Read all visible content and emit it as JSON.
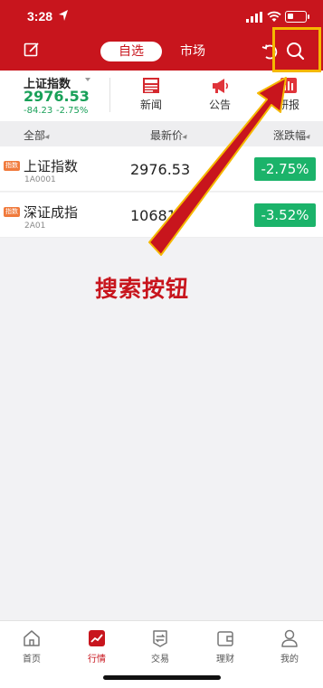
{
  "status_bar": {
    "time": "3:28"
  },
  "nav": {
    "tabs": [
      {
        "label": "自选",
        "active": true
      },
      {
        "label": "市场",
        "active": false
      }
    ]
  },
  "index_summary": {
    "name": "上证指数",
    "value": "2976.53",
    "change": "-84.23",
    "change_pct": "-2.75%",
    "color": "#18a058"
  },
  "quick_actions": [
    {
      "label": "新闻",
      "icon": "news-icon"
    },
    {
      "label": "公告",
      "icon": "megaphone-icon"
    },
    {
      "label": "研报",
      "icon": "research-report-icon"
    }
  ],
  "table": {
    "headers": {
      "name": "全部",
      "price": "最新价",
      "change_pct": "涨跌幅"
    },
    "rows": [
      {
        "badge": "指数",
        "name": "上证指数",
        "code": "1A0001",
        "price": "2976.53",
        "change_pct": "-2.75%"
      },
      {
        "badge": "指数",
        "name": "深证成指",
        "code": "2A01",
        "price": "10681.9",
        "change_pct": "-3.52%"
      }
    ]
  },
  "annotation": {
    "text": "搜索按钮"
  },
  "tabbar": {
    "items": [
      {
        "label": "首页",
        "icon": "home-icon",
        "active": false
      },
      {
        "label": "行情",
        "icon": "chart-icon",
        "active": true
      },
      {
        "label": "交易",
        "icon": "exchange-icon",
        "active": false
      },
      {
        "label": "理财",
        "icon": "wallet-icon",
        "active": false
      },
      {
        "label": "我的",
        "icon": "user-icon",
        "active": false
      }
    ]
  },
  "colors": {
    "brand_red": "#c8151d",
    "down_green": "#1bb36a",
    "highlight": "#f5b800"
  }
}
